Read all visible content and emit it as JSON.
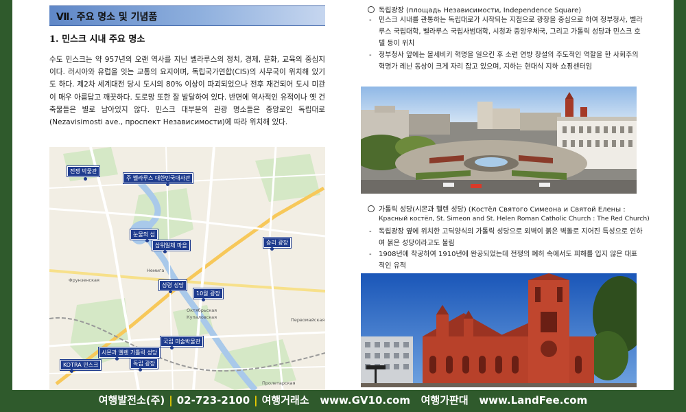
{
  "section": {
    "header": "Ⅶ. 주요 명소 및 기념품",
    "subtitle": "1. 민스크 시내 주요 명소",
    "paragraph": "수도 민스크는 약 957년의 오랜 역사를 지닌 벨라루스의 정치, 경제, 문화, 교육의 중심지이다. 러시아와 유럽을 잇는 교통의 요지이며, 독립국가연합(CIS)의 사무국이 위치해 있기도 하다. 제2차 세계대전 당시 도시의 80% 이상이 파괴되었으나 전후 재건되어 도시 미관이 매우 아름답고 깨끗하다. 도로망 또한 잘 발달하여 있다. 반면에 역사적인 유적이나 옛 건축물들은 별로 남아있지 않다. 민스크 대부분의 관광 명소들은 중앙로인 독립대로(Nezavisimosti ave., проспект Независимости)에 따라 위치해 있다."
  },
  "map": {
    "pins": [
      {
        "label": "전쟁 박물관"
      },
      {
        "label": "주 벨라루스 대한민국대사관"
      },
      {
        "label": "눈물의 섬"
      },
      {
        "label": "삼위일체 마을"
      },
      {
        "label": "승리 광장"
      },
      {
        "label": "성령 성당"
      },
      {
        "label": "10월 광장"
      },
      {
        "label": "국립 미술박물관"
      },
      {
        "label": "시몬과 엘렌 가톨릭 성당"
      },
      {
        "label": "독립 광장"
      },
      {
        "label": "KOTRA 민스크"
      }
    ],
    "labels": [
      "Фрунзенская",
      "Немига",
      "Октябрьская",
      "Купаловская",
      "Первомайская",
      "Пролетарская"
    ]
  },
  "right": {
    "item1": {
      "title": "독립광장 (площадь Независимости, Independence Square)",
      "bullets": [
        "민스크 시내를 관통하는 독립대로가 시작되는 지점으로 광장을 중심으로 하여 정부청사, 벨라루스 국립대학, 벨라루스 국립사범대학, 시청과 중앙우체국, 그리고 가톨릭 성당과 민스크 호텔 등이 위치",
        "정부청사 앞에는 볼세비키 혁명을 일으킨 후 소련 연방 창설의 주도적인 역할을 한 사회주의 혁명가 레닌 동상이 크게 자리 잡고 있으며, 지하는 현대식 지하 쇼핑센터임"
      ]
    },
    "item2": {
      "title": "가톨릭 성당(시몬과 헬렌 성당) (Костёл Святого Симеона и Святой Елены :",
      "title2": "Красный костёл, St. Simeon and St. Helen Roman Catholic Church : The Red Church)",
      "bullets": [
        "독립광장 옆에 위치한 고딕양식의 가톨릭 성당으로 외벽이 붉은 벽돌로 지어진 특성으로 인하여 붉은 성당이라고도 불림",
        "1908년에 착공하여 1910년에 완공되었는데 전쟁의 폐허 속에서도 피해를 입지 않은 대표적인 유적"
      ]
    }
  },
  "footer": {
    "part1": "여행발전소(주)",
    "phone": "02-723-2100",
    "part2": "여행거래소",
    "url1": "www.GV10.com",
    "part3": "여행가판대",
    "url2": "www.LandFee.com"
  },
  "colors": {
    "frame": "#2f5a2c",
    "header_blue": "#5f87c7",
    "pin_blue": "#1f3c8e",
    "brick": "#b8412a"
  }
}
